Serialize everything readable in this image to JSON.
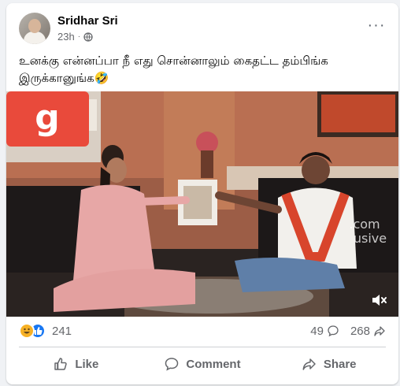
{
  "post": {
    "author": "Sridhar Sri",
    "time": "23h",
    "separator": "·",
    "caption": "உனக்கு என்னப்பா நீ எது சொன்னாலும் கைதட்ட தம்பிங்க இருக்கானுங்க🤣",
    "more_label": "···",
    "media": {
      "logo_letter": "g",
      "watermark": ".com",
      "watermark2": "usive"
    }
  },
  "stats": {
    "reaction_count": "241",
    "comment_count": "49",
    "share_count": "268"
  },
  "actions": {
    "like_label": "Like",
    "comment_label": "Comment",
    "share_label": "Share"
  },
  "colors": {
    "accent": "#1877f2",
    "secondary_text": "#65676b"
  }
}
